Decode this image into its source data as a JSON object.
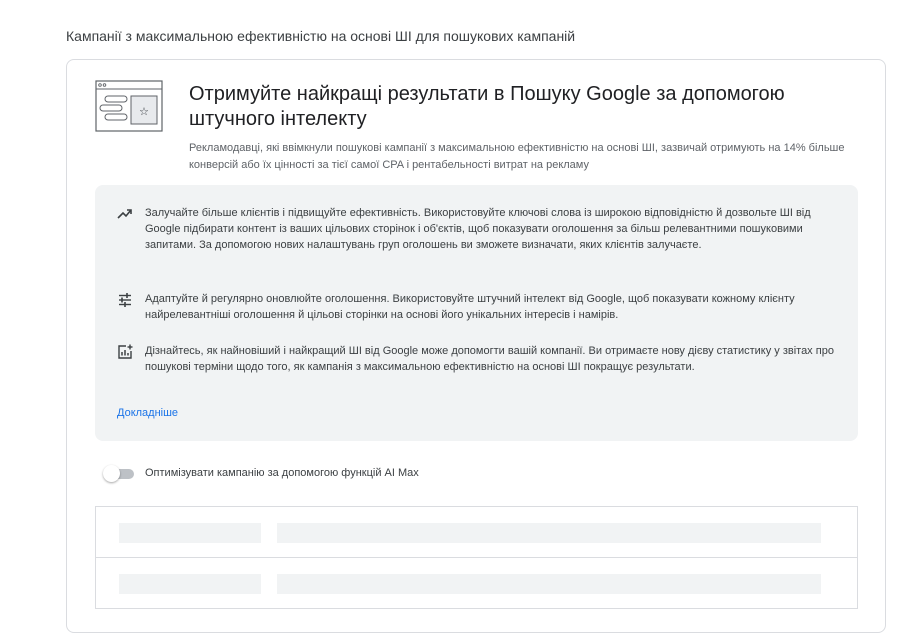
{
  "section": {
    "title": "Кампанії з максимальною ефективністю на основі ШІ для пошукових кампаній"
  },
  "hero": {
    "illustration_icon": "browser-window-sparkle-icon",
    "title": "Отримуйте найкращі результати в Пошуку Google за допомогою штучного інтелекту",
    "subtitle": "Рекламодавці, які ввімкнули пошукові кампанії з максимальною ефективністю на основі ШІ, зазвичай отримують на 14% більше конверсій або їх цінності за тієї самої CPA і рентабельності витрат на рекламу"
  },
  "info": {
    "items": [
      {
        "icon": "trending-up-icon",
        "text": "Залучайте більше клієнтів і підвищуйте ефективність. Використовуйте ключові слова із широкою відповідністю й дозвольте ШІ від Google підбирати контент із ваших цільових сторінок і об'єктів, щоб показувати оголошення за більш релевантними пошуковими запитами. За допомогою нових налаштувань груп оголошень ви зможете визначати, яких клієнтів залучаєте."
      },
      {
        "icon": "tune-icon",
        "text": "Адаптуйте й регулярно оновлюйте оголошення. Використовуйте штучний інтелект від Google, щоб показувати кожному клієнту найрелевантніші оголошення й цільові сторінки на основі його унікальних інтересів і намірів."
      },
      {
        "icon": "insights-icon",
        "text": "Дізнайтесь, як найновіший і найкращий ШІ від Google може допомогти вашій компанії. Ви отримаєте нову дієву статистику у звітах про пошукові терміни щодо того, як кампанія з максимальною ефективністю на основі ШІ покращує результати."
      }
    ],
    "learn_more": "Докладніше"
  },
  "toggle": {
    "label": "Оптимізувати кампанію за допомогою функцій AI Max",
    "state": "off"
  },
  "colors": {
    "link": "#1a73e8",
    "panel_bg": "#f1f3f4",
    "border": "#dadce0",
    "toggle_track_off": "#bdc1c6"
  }
}
